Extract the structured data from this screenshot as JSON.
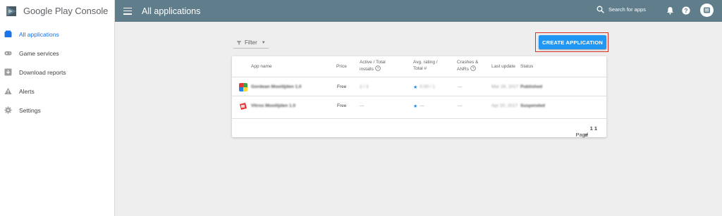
{
  "brand": {
    "name": "Google Play",
    "suffix": "Console"
  },
  "sidebar": {
    "items": [
      {
        "label": "All applications",
        "icon": "apps-icon",
        "active": true
      },
      {
        "label": "Game services",
        "icon": "gamepad-icon"
      },
      {
        "label": "Download reports",
        "icon": "download-icon"
      },
      {
        "label": "Alerts",
        "icon": "warning-icon"
      },
      {
        "label": "Settings",
        "icon": "gear-icon"
      }
    ]
  },
  "header": {
    "title": "All applications",
    "search_label": "Search for apps"
  },
  "toolbar": {
    "filter_label": "Filter",
    "create_label": "CREATE APPLICATION"
  },
  "table": {
    "columns": {
      "app_name": "App name",
      "price": "Price",
      "installs_1": "Active / Total",
      "installs_2": "installs",
      "rating_1": "Avg. rating /",
      "rating_2": "Total #",
      "crashes_1": "Crashes &",
      "crashes_2": "ANRs",
      "last_update": "Last update",
      "status": "Status"
    },
    "rows": [
      {
        "name": "Gordean Mooilijden 1.0",
        "price": "Free",
        "installs": "2 / 3",
        "rating": "0.00 / 1",
        "crashes": "—",
        "last_update": "Mar 28, 2017",
        "status": "Published"
      },
      {
        "name": "Vitros Mooilijden 1.0",
        "price": "Free",
        "installs": "—",
        "rating": "—",
        "crashes": "—",
        "last_update": "Apr 20, 2017",
        "status": "Suspended"
      }
    ],
    "pager": {
      "label": "Page",
      "current": "1",
      "of": "of",
      "total": "1"
    }
  },
  "colors": {
    "header_bg": "#607d8b",
    "accent": "#2196f3",
    "active_nav": "#1a73e8",
    "highlight_outline": "#d93025"
  }
}
